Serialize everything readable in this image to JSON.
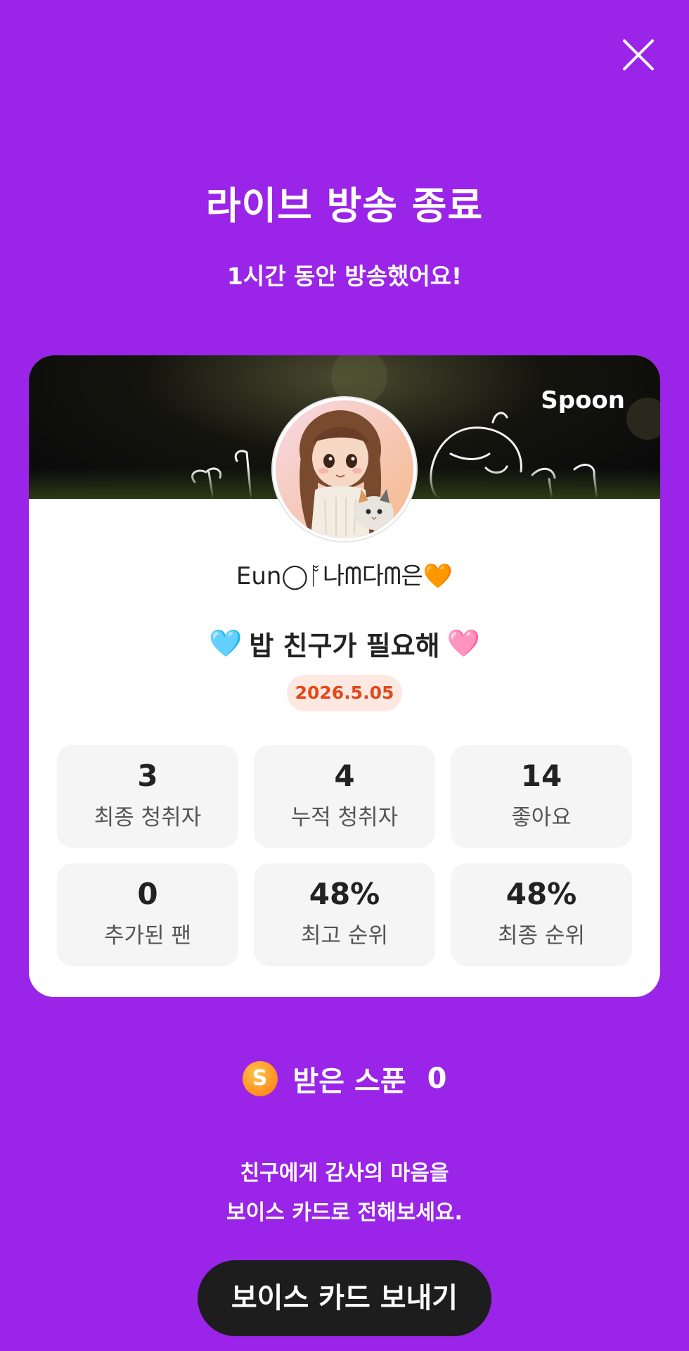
{
  "header": {
    "title": "라이브 방송 종료",
    "subtitle": "1시간 동안 방송했어요!"
  },
  "card": {
    "brand": "Spoon",
    "nickname": "Eun◯ᚩ나ᗰ다ᗰ은🧡",
    "room_title_prefix": "🩵",
    "room_title": "밥 친구가 필요해",
    "room_title_suffix": "🩷",
    "date": "2026.5.05",
    "stats": [
      {
        "value": "3",
        "label": "최종 청취자"
      },
      {
        "value": "4",
        "label": "누적 청취자"
      },
      {
        "value": "14",
        "label": "좋아요"
      },
      {
        "value": "0",
        "label": "추가된 팬"
      },
      {
        "value": "48%",
        "label": "최고 순위"
      },
      {
        "value": "48%",
        "label": "최종 순위"
      }
    ]
  },
  "spoon": {
    "coin_letter": "S",
    "label": "받은 스푼",
    "count": "0"
  },
  "message": {
    "line1": "친구에게 감사의 마음을",
    "line2": "보이스 카드로 전해보세요."
  },
  "cta": {
    "label": "보이스 카드 보내기"
  },
  "colors": {
    "background": "#9a24e8",
    "date_badge_text": "#e44818",
    "cta_background": "#1d1d1d"
  }
}
